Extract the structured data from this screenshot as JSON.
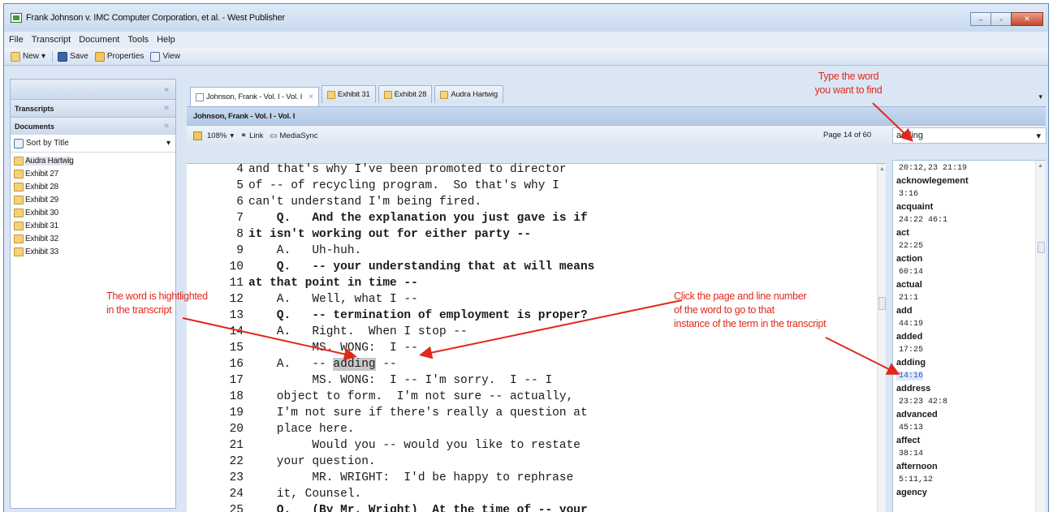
{
  "window": {
    "title": "Frank Johnson v. IMC Computer Corporation, et al. - West Publisher",
    "controls": [
      "–",
      "▫",
      "✕"
    ]
  },
  "menu": [
    "File",
    "Transcript",
    "Document",
    "Tools",
    "Help"
  ],
  "toolbar": {
    "new_label": "New",
    "new_dropdown": "▾",
    "save_label": "Save",
    "properties_label": "Properties",
    "view_label": "View"
  },
  "left_panel": {
    "collapse": "«",
    "transcripts_label": "Transcripts",
    "transcripts_chevron": "≈",
    "documents_label": "Documents",
    "documents_chevron": "≈",
    "sort_label": "Sort by Title",
    "sort_dropdown": "▾",
    "documents": [
      "Audra Hartwig",
      "Exhibit 27",
      "Exhibit 28",
      "Exhibit 29",
      "Exhibit 30",
      "Exhibit 31",
      "Exhibit 32",
      "Exhibit 33"
    ]
  },
  "tabs": [
    {
      "label": "Johnson, Frank - Vol. I - Vol. I",
      "close": "×"
    },
    {
      "label": "Exhibit 31"
    },
    {
      "label": "Exhibit 28"
    },
    {
      "label": "Audra Hartwig"
    }
  ],
  "tabs_dropdown": "▾",
  "document_title": "Johnson,  Frank - Vol. I - Vol. I",
  "viewer_toolbar": {
    "zoom": "108%",
    "zoom_dropdown": "▾",
    "link_label": "Link",
    "mediasync_label": "MediaSync",
    "page_indicator": "Page 14 of 60"
  },
  "search": {
    "value": "adding",
    "dropdown": "▾"
  },
  "transcript_lines": [
    {
      "num": "4",
      "text": "and that's why I've been promoted to director",
      "bold": false
    },
    {
      "num": "5",
      "text": "of -- of recycling program.  So that's why I",
      "bold": false
    },
    {
      "num": "6",
      "text": "can't understand I'm being fired.",
      "bold": false
    },
    {
      "num": "7",
      "text": "    Q.   And the explanation you just gave is if",
      "bold": true
    },
    {
      "num": "8",
      "text": "it isn't working out for either party --",
      "bold": true
    },
    {
      "num": "9",
      "text": "    A.   Uh-huh.",
      "bold": false
    },
    {
      "num": "10",
      "text": "    Q.   -- your understanding that at will means",
      "bold": true
    },
    {
      "num": "11",
      "text": "at that point in time --",
      "bold": true
    },
    {
      "num": "12",
      "text": "    A.   Well, what I --",
      "bold": false
    },
    {
      "num": "13",
      "text": "    Q.   -- termination of employment is proper?",
      "bold": true
    },
    {
      "num": "14",
      "text": "    A.   Right.  When I stop --",
      "bold": false
    },
    {
      "num": "15",
      "text": "         MS. WONG:  I --",
      "bold": false
    },
    {
      "num": "16",
      "pre": "    A.   -- ",
      "hl": "adding",
      "post": " --",
      "bold": false
    },
    {
      "num": "17",
      "text": "         MS. WONG:  I -- I'm sorry.  I -- I",
      "bold": false
    },
    {
      "num": "18",
      "text": "    object to form.  I'm not sure -- actually,",
      "bold": false
    },
    {
      "num": "19",
      "text": "    I'm not sure if there's really a question at",
      "bold": false
    },
    {
      "num": "20",
      "text": "    place here.",
      "bold": false
    },
    {
      "num": "21",
      "text": "         Would you -- would you like to restate",
      "bold": false
    },
    {
      "num": "22",
      "text": "    your question.",
      "bold": false
    },
    {
      "num": "23",
      "text": "         MR. WRIGHT:  I'd be happy to rephrase",
      "bold": false
    },
    {
      "num": "24",
      "text": "    it, Counsel.",
      "bold": false
    },
    {
      "num": "25",
      "text": "    Q.   (By Mr. Wright)  At the time of -- your",
      "bold": true
    }
  ],
  "word_index": [
    {
      "type": "refs",
      "text": "20:12,23 21:19"
    },
    {
      "type": "word",
      "text": "acknowlegement"
    },
    {
      "type": "refs",
      "text": "3:16"
    },
    {
      "type": "word",
      "text": "acquaint"
    },
    {
      "type": "refs",
      "text": "24:22 46:1"
    },
    {
      "type": "word",
      "text": "act"
    },
    {
      "type": "refs",
      "text": "22:25"
    },
    {
      "type": "word",
      "text": "action"
    },
    {
      "type": "refs",
      "text": "60:14"
    },
    {
      "type": "word",
      "text": "actual"
    },
    {
      "type": "refs",
      "text": "21:1"
    },
    {
      "type": "word",
      "text": "add"
    },
    {
      "type": "refs",
      "text": "44:19"
    },
    {
      "type": "word",
      "text": "added"
    },
    {
      "type": "refs",
      "text": "17:25"
    },
    {
      "type": "word",
      "text": "adding"
    },
    {
      "type": "refs",
      "text": "14:16",
      "active": true
    },
    {
      "type": "word",
      "text": "address"
    },
    {
      "type": "refs",
      "text": "23:23 42:8"
    },
    {
      "type": "word",
      "text": "advanced"
    },
    {
      "type": "refs",
      "text": "45:13"
    },
    {
      "type": "word",
      "text": "affect"
    },
    {
      "type": "refs",
      "text": "38:14"
    },
    {
      "type": "word",
      "text": "afternoon"
    },
    {
      "type": "refs",
      "text": "5:11,12"
    },
    {
      "type": "word",
      "text": "agency"
    }
  ],
  "annotations": {
    "type_word": [
      "Type the word",
      "you want to find"
    ],
    "highlighted": [
      "The word is hightlighted",
      "in the transcript"
    ],
    "click_page": [
      "Click the page and line number",
      "of the word to go to that",
      "instance of the term in the transcript"
    ],
    "color": "#e0291c"
  }
}
